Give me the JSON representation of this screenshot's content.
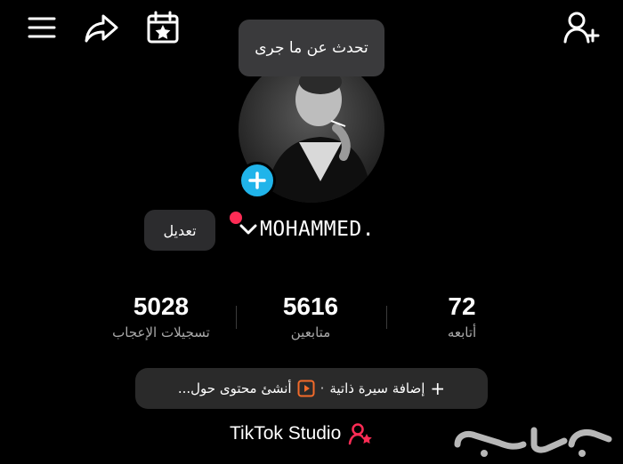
{
  "header": {
    "menu_icon": "hamburger-menu-icon",
    "share_icon": "share-arrow-icon",
    "calendar_icon": "calendar-star-icon",
    "add_user_icon": "add-user-icon"
  },
  "tooltip": {
    "text": "تحدث عن ما جرى"
  },
  "profile": {
    "edit_label": "تعديل",
    "username": "MOHAMMED."
  },
  "stats": [
    {
      "value": "5028",
      "label": "تسجيلات الإعجاب"
    },
    {
      "value": "5616",
      "label": "متابعين"
    },
    {
      "value": "72",
      "label": "أتابعه"
    }
  ],
  "bio": {
    "add_bio": "إضافة سيرة ذاتية",
    "separator": "·",
    "create_content": "أنشئ محتوى حول..."
  },
  "studio": {
    "label": "TikTok Studio"
  },
  "colors": {
    "accent_blue": "#20b4ea",
    "accent_red": "#fe2c55",
    "bg": "#000000",
    "chip_bg": "#2a2a2a"
  }
}
